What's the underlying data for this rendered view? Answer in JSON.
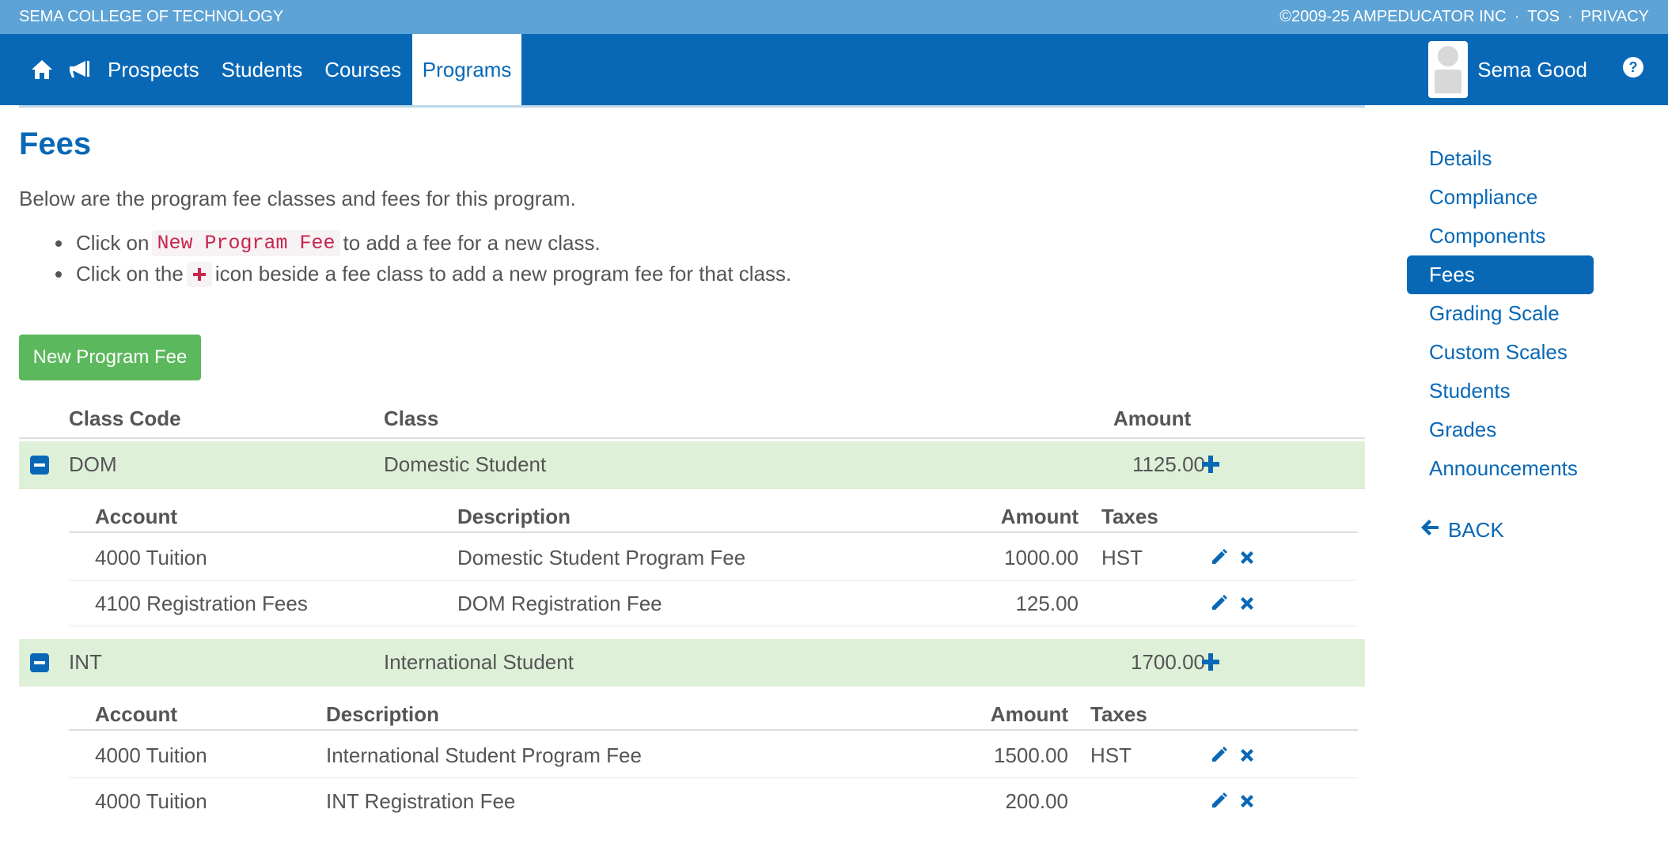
{
  "topbar": {
    "org": "SEMA COLLEGE OF TECHNOLOGY",
    "copyright": "©2009-25 AMPEDUCATOR INC",
    "tos": "TOS",
    "privacy": "PRIVACY",
    "sep": "·"
  },
  "nav": {
    "links": [
      "Prospects",
      "Students",
      "Courses",
      "Programs"
    ],
    "active": "Programs",
    "user_name": "Sema Good"
  },
  "page": {
    "title": "Fees",
    "intro": "Below are the program fee classes and fees for this program.",
    "bullet1_pre": "Click on",
    "bullet1_code": "New Program Fee",
    "bullet1_post": "to add a fee for a new class.",
    "bullet2_pre": "Click on the",
    "bullet2_post": "icon beside a fee class to add a new program fee for that class.",
    "new_button": "New Program Fee"
  },
  "table": {
    "headers": {
      "class_code": "Class Code",
      "class": "Class",
      "amount": "Amount"
    },
    "sub_headers": {
      "account": "Account",
      "description": "Description",
      "amount": "Amount",
      "taxes": "Taxes"
    },
    "classes": [
      {
        "code": "DOM",
        "name": "Domestic Student",
        "amount": "1125.00",
        "fees": [
          {
            "account": "4000 Tuition",
            "description": "Domestic Student Program Fee",
            "amount": "1000.00",
            "taxes": "HST"
          },
          {
            "account": "4100 Registration Fees",
            "description": "DOM Registration Fee",
            "amount": "125.00",
            "taxes": ""
          }
        ]
      },
      {
        "code": "INT",
        "name": "International Student",
        "amount": "1700.00",
        "fees": [
          {
            "account": "4000 Tuition",
            "description": "International Student Program Fee",
            "amount": "1500.00",
            "taxes": "HST"
          },
          {
            "account": "4000 Tuition",
            "description": "INT Registration Fee",
            "amount": "200.00",
            "taxes": ""
          }
        ]
      }
    ]
  },
  "sidenav": {
    "items": [
      "Details",
      "Compliance",
      "Components",
      "Fees",
      "Grading Scale",
      "Custom Scales",
      "Students",
      "Grades",
      "Announcements"
    ],
    "active": "Fees",
    "back": "BACK"
  },
  "colors": {
    "primary": "#0868b6",
    "topbar": "#5ea3d5",
    "success": "#5cb85c",
    "row_green": "#dff0d8"
  },
  "icons": [
    "home-icon",
    "megaphone-icon",
    "question-circle-icon",
    "minus-square-icon",
    "plus-icon",
    "pencil-icon",
    "times-icon",
    "arrow-left-icon"
  ]
}
